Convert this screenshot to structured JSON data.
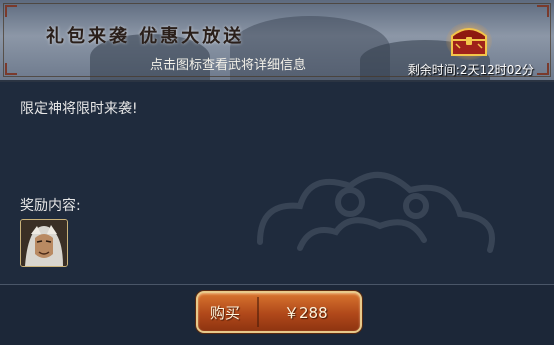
{
  "banner": {
    "title": "礼包来袭  优惠大放送",
    "subtitle": "点击图标查看武将详细信息",
    "countdown": "剩余时间:2天12时02分",
    "chest_icon": "treasure-chest-icon"
  },
  "content": {
    "description": "限定神将限时来袭!",
    "reward_label": "奖励内容:",
    "reward_items": [
      {
        "icon": "general-portrait"
      }
    ]
  },
  "footer": {
    "buy_label": "购买",
    "price": "￥288"
  },
  "colors": {
    "button_accent": "#c35a22",
    "background": "#1f2b3d",
    "banner": "#7d889a"
  }
}
